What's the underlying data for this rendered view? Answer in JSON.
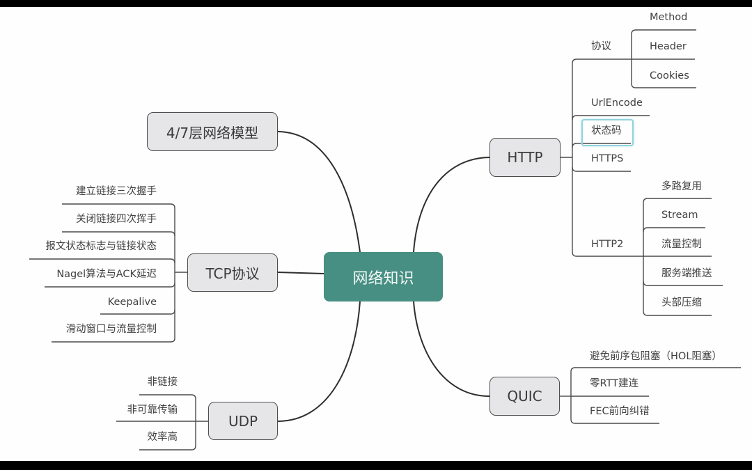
{
  "mindmap": {
    "root": {
      "label": "网络知识",
      "color": "#468f82"
    },
    "topics": {
      "model": {
        "label": "4/7层网络模型"
      },
      "tcp": {
        "label": "TCP协议",
        "children": [
          "建立链接三次握手",
          "关闭链接四次挥手",
          "报文状态标志与链接状态",
          "Nagel算法与ACK延迟",
          "Keepalive",
          "滑动窗口与流量控制"
        ]
      },
      "udp": {
        "label": "UDP",
        "children": [
          "非链接",
          "非可靠传输",
          "效率高"
        ]
      },
      "http": {
        "label": "HTTP",
        "children": {
          "protocol": {
            "label": "协议",
            "children": [
              "Method",
              "Header",
              "Cookies"
            ]
          },
          "urlencode": {
            "label": "UrlEncode"
          },
          "status": {
            "label": "状态码",
            "selected": true
          },
          "https": {
            "label": "HTTPS"
          },
          "http2": {
            "label": "HTTP2",
            "children": [
              "多路复用",
              "Stream",
              "流量控制",
              "服务端推送",
              "头部压缩"
            ]
          }
        }
      },
      "quic": {
        "label": "QUIC",
        "children": [
          "避免前序包阻塞（HOL阻塞）",
          "零RTT建连",
          "FEC前向纠错"
        ]
      }
    },
    "selection_color": "#8fd3dc"
  }
}
